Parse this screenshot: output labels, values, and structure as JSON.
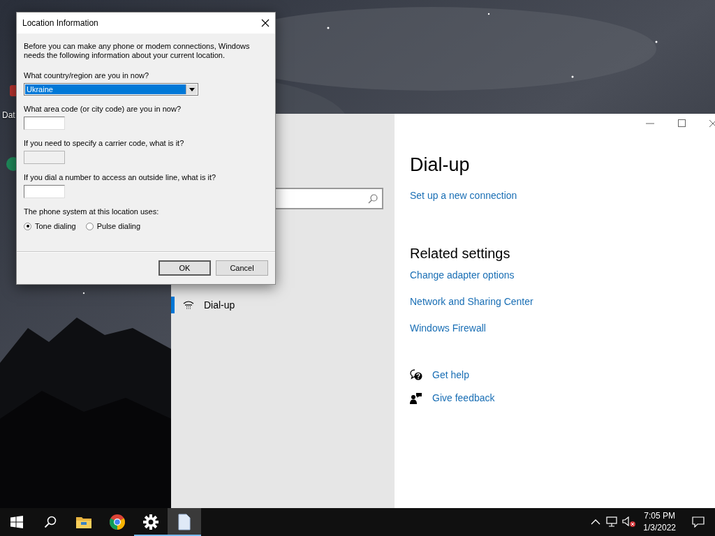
{
  "desktop": {
    "icon_labels": [
      "Dat"
    ]
  },
  "dialog": {
    "title": "Location Information",
    "intro": "Before you can make any phone or modem connections, Windows needs the following information about your current location.",
    "fields": [
      {
        "kind": "select",
        "label": "What country/region are you in now?",
        "value": "Ukraine",
        "disabled": false
      },
      {
        "kind": "text",
        "label": "What area code (or city code) are you in now?",
        "disabled": false
      },
      {
        "kind": "text",
        "label": "If you need to specify a carrier code, what is it?",
        "disabled": true
      },
      {
        "kind": "text",
        "label": "If you dial a number to access an outside line, what is it?",
        "disabled": false
      }
    ],
    "dialing_label": "The phone system at this location uses:",
    "dialing": [
      {
        "label": "Tone dialing",
        "selected": true
      },
      {
        "label": "Pulse dialing",
        "selected": false
      }
    ],
    "buttons": [
      {
        "label": "OK",
        "default": true
      },
      {
        "label": "Cancel",
        "default": false
      }
    ]
  },
  "settings": {
    "nav": [
      {
        "label": "Dial-up",
        "selected": true
      }
    ],
    "title": "Dial-up",
    "setup_link": "Set up a new connection",
    "related_heading": "Related settings",
    "related_links": [
      "Change adapter options",
      "Network and Sharing Center",
      "Windows Firewall"
    ],
    "support_links": [
      {
        "kind": "help",
        "label": "Get help"
      },
      {
        "kind": "feedback",
        "label": "Give feedback"
      }
    ]
  },
  "taskbar": {
    "apps": [
      {
        "kind": "explorer",
        "running": false,
        "selected": false
      },
      {
        "kind": "chrome",
        "running": false,
        "selected": false
      },
      {
        "kind": "settings",
        "running": true,
        "selected": false
      },
      {
        "kind": "document",
        "running": true,
        "selected": true
      }
    ],
    "time": "7:05 PM",
    "date": "1/3/2022"
  }
}
